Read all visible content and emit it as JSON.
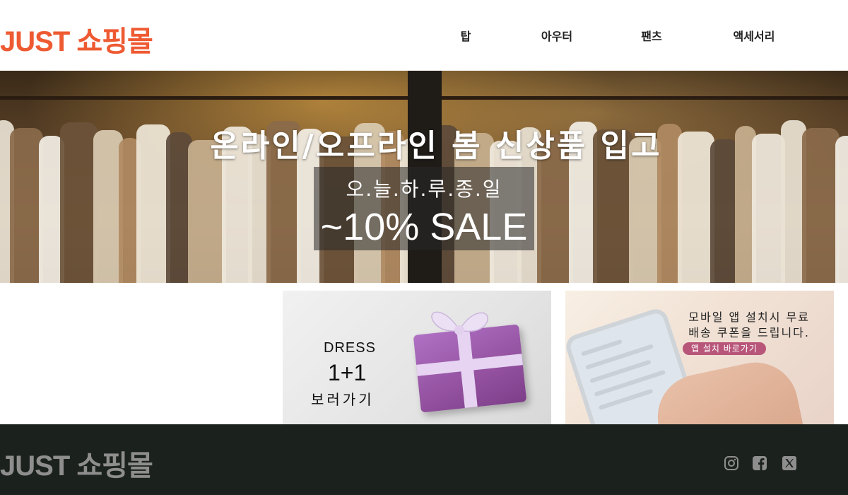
{
  "header": {
    "logo": "JUST 쇼핑몰",
    "nav": [
      {
        "label": "탑"
      },
      {
        "label": "아우터"
      },
      {
        "label": "팬츠"
      },
      {
        "label": "액세서리"
      }
    ]
  },
  "hero": {
    "title": "온라인/오프라인 봄 신상품 입고",
    "subtitle": "오.늘.하.루.종.일",
    "sale": "~10% SALE"
  },
  "promos": {
    "dress": {
      "label": "DRESS",
      "offer": "1+1",
      "link": "보러가기"
    },
    "app": {
      "line1": "모바일 앱 설치시 무료",
      "line2": "배송 쿠폰을 드립니다.",
      "button": "앱 설치 바로가기"
    }
  },
  "footer": {
    "logo": "JUST 쇼핑몰",
    "social": [
      {
        "icon": "instagram-icon"
      },
      {
        "icon": "facebook-icon"
      },
      {
        "icon": "x-twitter-icon"
      }
    ]
  },
  "colors": {
    "brand": "#ee5a32",
    "footer_bg": "#1b211c",
    "footer_text": "#8e8e8e",
    "app_button": "#b8567a"
  }
}
